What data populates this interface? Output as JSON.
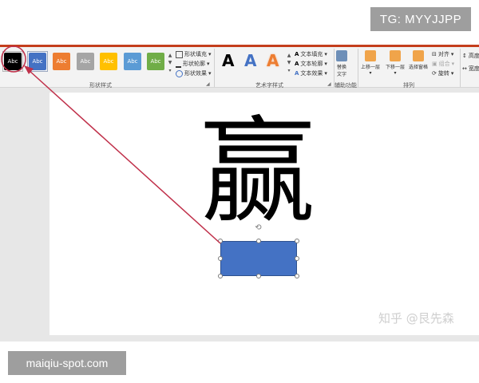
{
  "watermarks": {
    "top_badge": "TG: MYYJJPP",
    "bottom_badge": "maiqiu-spot.com",
    "zhihu": "知乎 @艮先森"
  },
  "ribbon": {
    "shape_styles": {
      "swatch_text": "Abc",
      "swatches": [
        {
          "color": "#000000",
          "selected": true
        },
        {
          "color": "#4472c4",
          "selected": false
        },
        {
          "color": "#ed7d31",
          "selected": false
        },
        {
          "color": "#a5a5a5",
          "selected": false
        },
        {
          "color": "#ffc000",
          "selected": false
        },
        {
          "color": "#5b9bd5",
          "selected": false
        },
        {
          "color": "#70ad47",
          "selected": false
        }
      ],
      "fill": "形状填充",
      "outline": "形状轮廓",
      "effects": "形状效果",
      "group_label": "形状样式"
    },
    "wordart": {
      "letter": "A",
      "colors": [
        "#000000",
        "#4472c4",
        "#ed7d31"
      ],
      "text_fill": "文本填充",
      "text_outline": "文本轮廓",
      "text_effects": "文本效果",
      "group_label": "艺术字样式"
    },
    "accessibility": {
      "alt_text_line1": "替换",
      "alt_text_line2": "文字",
      "group_label": "辅助功能"
    },
    "arrange": {
      "bring_forward": "上移一层",
      "send_backward": "下移一层",
      "selection_pane": "选择窗格",
      "align": "对齐",
      "group": "组合",
      "rotate": "旋转",
      "group_label": "排列"
    },
    "size": {
      "height": "高度",
      "width": "宽度"
    }
  },
  "slide": {
    "glyph": "赢"
  },
  "colors": {
    "accent": "#c43e1c",
    "arrow": "#c0304a",
    "shape_fill": "#4472c4"
  }
}
